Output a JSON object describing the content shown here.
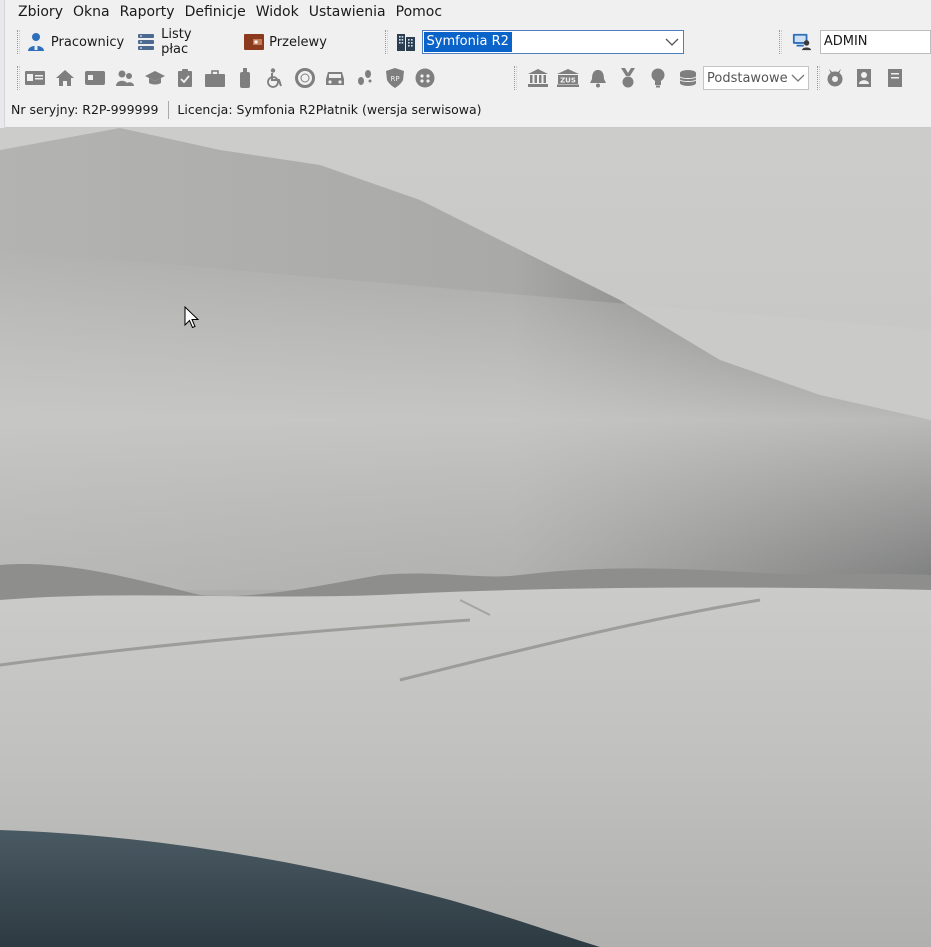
{
  "menu": {
    "items": [
      "Zbiory",
      "Okna",
      "Raporty",
      "Definicje",
      "Widok",
      "Ustawienia",
      "Pomoc"
    ]
  },
  "toolbar": {
    "employees_label": "Pracownicy",
    "payrolls_label": "Listy płac",
    "transfers_label": "Przelewy",
    "company_value": "Symfonia R2",
    "user_value": "ADMIN",
    "filter_value": "Podstawowe"
  },
  "status": {
    "serial": "Nr seryjny: R2P-999999",
    "license": "Licencja: Symfonia R2Płatnik (wersja serwisowa)"
  },
  "icons": {
    "row2_left": [
      "id-card-icon",
      "home-icon",
      "card-icon",
      "people-icon",
      "graduation-cap-icon",
      "clipboard-icon",
      "briefcase-icon",
      "bottle-icon",
      "wheelchair-icon",
      "lifebuoy-icon",
      "car-icon",
      "footsteps-icon",
      "shield-icon",
      "badge-icon"
    ],
    "row2_right": [
      "bank-icon",
      "zus-icon",
      "bell-icon",
      "medal-icon",
      "bulb-icon",
      "coins-icon"
    ],
    "row2_far": [
      "award-icon",
      "person-document-icon",
      "document-icon"
    ]
  },
  "colors": {
    "accent": "#0a63c9",
    "toolbar_bg": "#f0f0f0",
    "icon_gray": "#7f7f7f",
    "brand_brown": "#8b3a1e",
    "brand_blue": "#2d6fba"
  }
}
